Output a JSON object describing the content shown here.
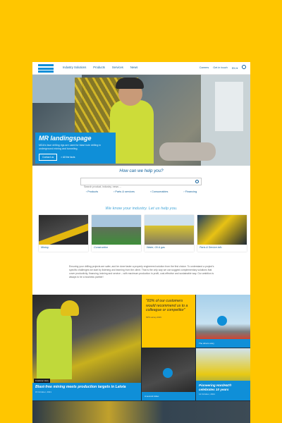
{
  "header": {
    "nav": [
      "Industry Solutions",
      "Products",
      "Services",
      "News"
    ],
    "util": [
      "Careers",
      "Get in touch",
      "EN ▾"
    ]
  },
  "hero": {
    "title": "MR landingspage",
    "text": "MDA's face drilling rigs are used for blast hole drilling in underground mining and tunneling.",
    "btn_primary": "Contact us",
    "btn_secondary": "> All the facts"
  },
  "help": {
    "title": "How can we help you?",
    "search_placeholder": "Search product, industry, news ...",
    "categories": [
      "› Products",
      "› Parts & services",
      "› Consumables",
      "› Financing"
    ]
  },
  "industry": {
    "title": "We know your industry. Let us help you.",
    "cards": [
      "Mining",
      "Construction",
      "Water, Oil & gas",
      "Parts & Service info"
    ]
  },
  "intro": "Ensuring your drilling projects are safer, and be done faster a properly engineered solution from the first choice. To understand a project's specific challenges we start by listening and learning from the client. That is the only way we can suggest complementary solutions that cover productivity, financing, training and service – with maximum production in profit, cost-effective and sustainable way. Our ambition is always to be a business partner!",
  "news": {
    "feature": {
      "tag": "Customer story",
      "title": "Blast-free mining meets production targets in Latvia",
      "date": "15 October, 2021"
    },
    "quote": {
      "text": "\"83% of our customers would recommend us to a colleague or competitor\"",
      "source": "NPS survey 2019"
    },
    "video1": "The drive's story",
    "video2": "A second video",
    "hardhat": {
      "title": "Pioneering HardHat® celebrates 10 years",
      "date": "12 October, 2021"
    }
  },
  "colors": {
    "brand": "#0f8fd8",
    "accent": "#ffc600",
    "nav": "#0f5f99"
  }
}
